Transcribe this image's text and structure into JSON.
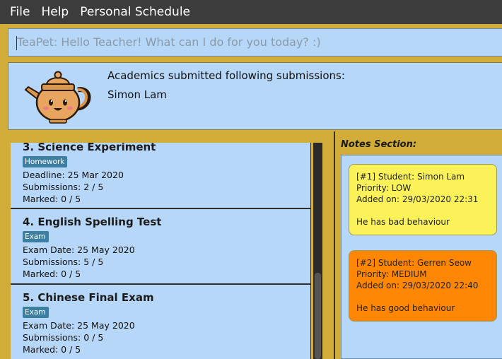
{
  "menu": {
    "items": [
      "File",
      "Help",
      "Personal Schedule"
    ]
  },
  "command": {
    "placeholder": "TeaPet: Hello Teacher! What can I do for you today? :)"
  },
  "result": {
    "line1": "Academics submitted following submissions:",
    "line2": "Simon Lam"
  },
  "assessments": [
    {
      "title": "3.  Science Experiment",
      "tag": "Homework",
      "date": "Deadline: 25 Mar 2020",
      "submissions": "Submissions: 2 / 5",
      "marked": "Marked: 0 / 5"
    },
    {
      "title": "4.  English Spelling Test",
      "tag": "Exam",
      "date": "Exam Date: 25 May 2020",
      "submissions": "Submissions: 5 / 5",
      "marked": "Marked: 0 / 5"
    },
    {
      "title": "5.  Chinese Final Exam",
      "tag": "Exam",
      "date": "Exam Date: 25 May 2020",
      "submissions": "Submissions: 0 / 5",
      "marked": "Marked: 0 / 5"
    }
  ],
  "notes": {
    "title": "Notes Section:",
    "items": [
      {
        "header": "[#1] Student: Simon Lam",
        "priority": "Priority: LOW",
        "added": "Added on: 29/03/2020 22:31",
        "content": "He has bad behaviour",
        "color": "#fbf25a"
      },
      {
        "header": "[#2] Student: Gerren Seow",
        "priority": "Priority: MEDIUM",
        "added": "Added on: 29/03/2020 22:40",
        "content": "He has good behaviour",
        "color": "#fd8705"
      }
    ]
  },
  "colors": {
    "accent": "#d2ac38",
    "panel": "#b7d7f8",
    "tag": "#3c7fa1",
    "menubar": "#3c3c3c"
  }
}
